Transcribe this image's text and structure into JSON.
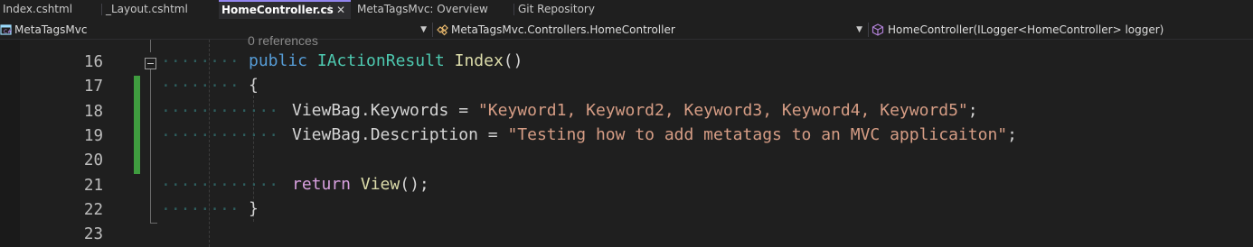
{
  "tabs": [
    {
      "label": "Index.cshtml",
      "active": false
    },
    {
      "label": "_Layout.cshtml",
      "active": false
    },
    {
      "label": "HomeController.cs",
      "active": true
    },
    {
      "label": "MetaTagsMvc: Overview",
      "active": false
    },
    {
      "label": "Git Repository",
      "active": false
    }
  ],
  "active_tab_pin": "⊣",
  "active_tab_close": "✕",
  "nav": {
    "project": "MetaTagsMvc",
    "class": "MetaTagsMvc.Controllers.HomeController",
    "member": "HomeController(ILogger<HomeController> logger)"
  },
  "editor": {
    "codelens": "0 references",
    "line_numbers": [
      "16",
      "17",
      "18",
      "19",
      "20",
      "21",
      "22",
      "23"
    ],
    "lines": {
      "l16": {
        "kw": "public",
        "type": "IActionResult",
        "method": "Index",
        "parens": "()"
      },
      "l17": {
        "brace": "{"
      },
      "l18": {
        "obj": "ViewBag",
        "prop": "Keywords",
        "op": " = ",
        "str": "\"Keyword1, Keyword2, Keyword3, Keyword4, Keyword5\"",
        "end": ";"
      },
      "l19": {
        "obj": "ViewBag",
        "prop": "Description",
        "op": " = ",
        "str": "\"Testing how to add metatags to an MVC applicaiton\"",
        "end": ";"
      },
      "l21": {
        "kw": "return",
        "method": "View",
        "end": "();"
      },
      "l22": {
        "brace": "}"
      }
    }
  },
  "colors": {
    "background": "#1f1f1f",
    "keyword": "#569cd6",
    "type": "#4ec9b0",
    "method": "#dcdcaa",
    "string": "#d69d85",
    "control_keyword": "#d8a0df",
    "change_bar": "#3f9c3f",
    "active_tab_accent": "#9184ee"
  }
}
